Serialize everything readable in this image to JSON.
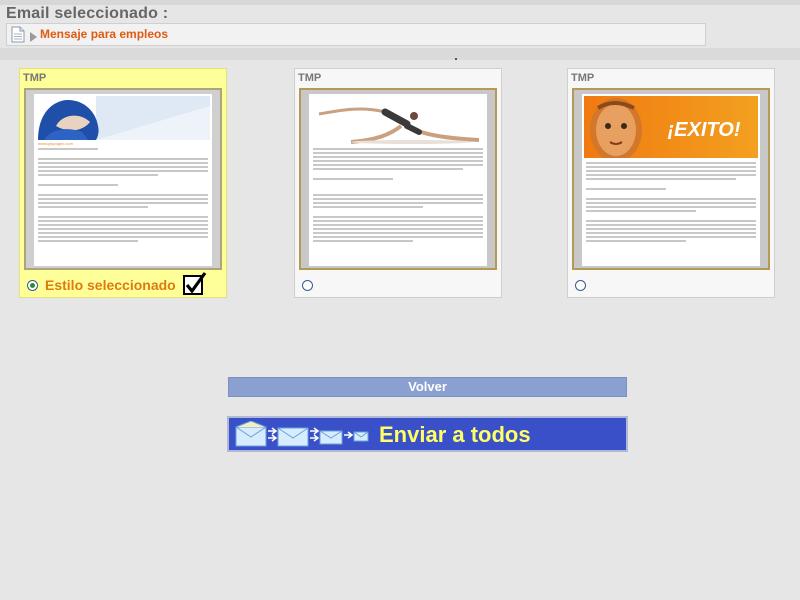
{
  "header": {
    "title": "Email seleccionado :",
    "subject": "Mensaje para empleos"
  },
  "templates": [
    {
      "label": "TMP",
      "selected": true,
      "selected_text": "Estilo seleccionado",
      "hero": "woman-blue",
      "site_text": "www.grupogec.com"
    },
    {
      "label": "TMP",
      "selected": false,
      "hero": "yoga"
    },
    {
      "label": "TMP",
      "selected": false,
      "hero": "exito",
      "hero_text": "¡EXITO!"
    }
  ],
  "buttons": {
    "back": "Volver",
    "send_all": "Enviar a todos"
  },
  "colors": {
    "accent_orange": "#e05a12",
    "selected_bg": "#ffff99",
    "send_bg": "#3a50c8",
    "send_text": "#ffff66",
    "back_bg": "#8aa0d0"
  }
}
